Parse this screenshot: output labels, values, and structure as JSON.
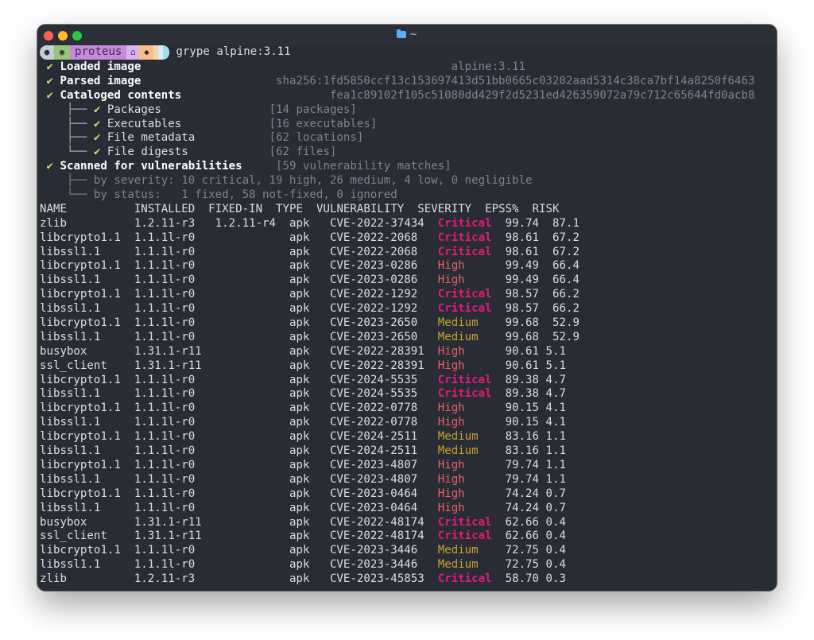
{
  "window": {
    "title": "~"
  },
  "prompt": {
    "host": "proteus",
    "command": "grype alpine:3.11"
  },
  "status": {
    "loaded_label": "Loaded image",
    "loaded_value": "alpine:3.11",
    "parsed_label": "Parsed image",
    "parsed_value": "sha256:1fd5850ccf13c153697413d51bb0665c03202aad5314c38ca7bf14a8250f6463",
    "cataloged_label": "Cataloged contents",
    "cataloged_value": "fea1c89102f105c51080dd429f2d5231ed426359072a79c712c65644fd0acb8",
    "sub": [
      {
        "label": "Packages",
        "value": "[14 packages]"
      },
      {
        "label": "Executables",
        "value": "[16 executables]"
      },
      {
        "label": "File metadata",
        "value": "[62 locations]"
      },
      {
        "label": "File digests",
        "value": "[62 files]"
      }
    ],
    "scanned_label": "Scanned for vulnerabilities",
    "scanned_value": "[59 vulnerability matches]",
    "severity_label": "by severity:",
    "severity_value": "10 critical, 19 high, 26 medium, 4 low, 0 negligible",
    "status_label": "by status:",
    "status_value": "1 fixed, 58 not-fixed, 0 ignored"
  },
  "table": {
    "headers": [
      "NAME",
      "INSTALLED",
      "FIXED-IN",
      "TYPE",
      "VULNERABILITY",
      "SEVERITY",
      "EPSS%",
      "RISK"
    ],
    "rows": [
      [
        "zlib",
        "1.2.11-r3",
        "1.2.11-r4",
        "apk",
        "CVE-2022-37434",
        "Critical",
        "99.74",
        "87.1"
      ],
      [
        "libcrypto1.1",
        "1.1.1l-r0",
        "",
        "apk",
        "CVE-2022-2068",
        "Critical",
        "98.61",
        "67.2"
      ],
      [
        "libssl1.1",
        "1.1.1l-r0",
        "",
        "apk",
        "CVE-2022-2068",
        "Critical",
        "98.61",
        "67.2"
      ],
      [
        "libcrypto1.1",
        "1.1.1l-r0",
        "",
        "apk",
        "CVE-2023-0286",
        "High",
        "99.49",
        "66.4"
      ],
      [
        "libssl1.1",
        "1.1.1l-r0",
        "",
        "apk",
        "CVE-2023-0286",
        "High",
        "99.49",
        "66.4"
      ],
      [
        "libcrypto1.1",
        "1.1.1l-r0",
        "",
        "apk",
        "CVE-2022-1292",
        "Critical",
        "98.57",
        "66.2"
      ],
      [
        "libssl1.1",
        "1.1.1l-r0",
        "",
        "apk",
        "CVE-2022-1292",
        "Critical",
        "98.57",
        "66.2"
      ],
      [
        "libcrypto1.1",
        "1.1.1l-r0",
        "",
        "apk",
        "CVE-2023-2650",
        "Medium",
        "99.68",
        "52.9"
      ],
      [
        "libssl1.1",
        "1.1.1l-r0",
        "",
        "apk",
        "CVE-2023-2650",
        "Medium",
        "99.68",
        "52.9"
      ],
      [
        "busybox",
        "1.31.1-r11",
        "",
        "apk",
        "CVE-2022-28391",
        "High",
        "90.61",
        "5.1"
      ],
      [
        "ssl_client",
        "1.31.1-r11",
        "",
        "apk",
        "CVE-2022-28391",
        "High",
        "90.61",
        "5.1"
      ],
      [
        "libcrypto1.1",
        "1.1.1l-r0",
        "",
        "apk",
        "CVE-2024-5535",
        "Critical",
        "89.38",
        "4.7"
      ],
      [
        "libssl1.1",
        "1.1.1l-r0",
        "",
        "apk",
        "CVE-2024-5535",
        "Critical",
        "89.38",
        "4.7"
      ],
      [
        "libcrypto1.1",
        "1.1.1l-r0",
        "",
        "apk",
        "CVE-2022-0778",
        "High",
        "90.15",
        "4.1"
      ],
      [
        "libssl1.1",
        "1.1.1l-r0",
        "",
        "apk",
        "CVE-2022-0778",
        "High",
        "90.15",
        "4.1"
      ],
      [
        "libcrypto1.1",
        "1.1.1l-r0",
        "",
        "apk",
        "CVE-2024-2511",
        "Medium",
        "83.16",
        "1.1"
      ],
      [
        "libssl1.1",
        "1.1.1l-r0",
        "",
        "apk",
        "CVE-2024-2511",
        "Medium",
        "83.16",
        "1.1"
      ],
      [
        "libcrypto1.1",
        "1.1.1l-r0",
        "",
        "apk",
        "CVE-2023-4807",
        "High",
        "79.74",
        "1.1"
      ],
      [
        "libssl1.1",
        "1.1.1l-r0",
        "",
        "apk",
        "CVE-2023-4807",
        "High",
        "79.74",
        "1.1"
      ],
      [
        "libcrypto1.1",
        "1.1.1l-r0",
        "",
        "apk",
        "CVE-2023-0464",
        "High",
        "74.24",
        "0.7"
      ],
      [
        "libssl1.1",
        "1.1.1l-r0",
        "",
        "apk",
        "CVE-2023-0464",
        "High",
        "74.24",
        "0.7"
      ],
      [
        "busybox",
        "1.31.1-r11",
        "",
        "apk",
        "CVE-2022-48174",
        "Critical",
        "62.66",
        "0.4"
      ],
      [
        "ssl_client",
        "1.31.1-r11",
        "",
        "apk",
        "CVE-2022-48174",
        "Critical",
        "62.66",
        "0.4"
      ],
      [
        "libcrypto1.1",
        "1.1.1l-r0",
        "",
        "apk",
        "CVE-2023-3446",
        "Medium",
        "72.75",
        "0.4"
      ],
      [
        "libssl1.1",
        "1.1.1l-r0",
        "",
        "apk",
        "CVE-2023-3446",
        "Medium",
        "72.75",
        "0.4"
      ],
      [
        "zlib",
        "1.2.11-r3",
        "",
        "apk",
        "CVE-2023-45853",
        "Critical",
        "58.70",
        "0.3"
      ]
    ]
  },
  "colors": {
    "critical": "#e6197c",
    "high": "#ef5f6d",
    "medium": "#cba031",
    "check": "#c2e07a"
  }
}
